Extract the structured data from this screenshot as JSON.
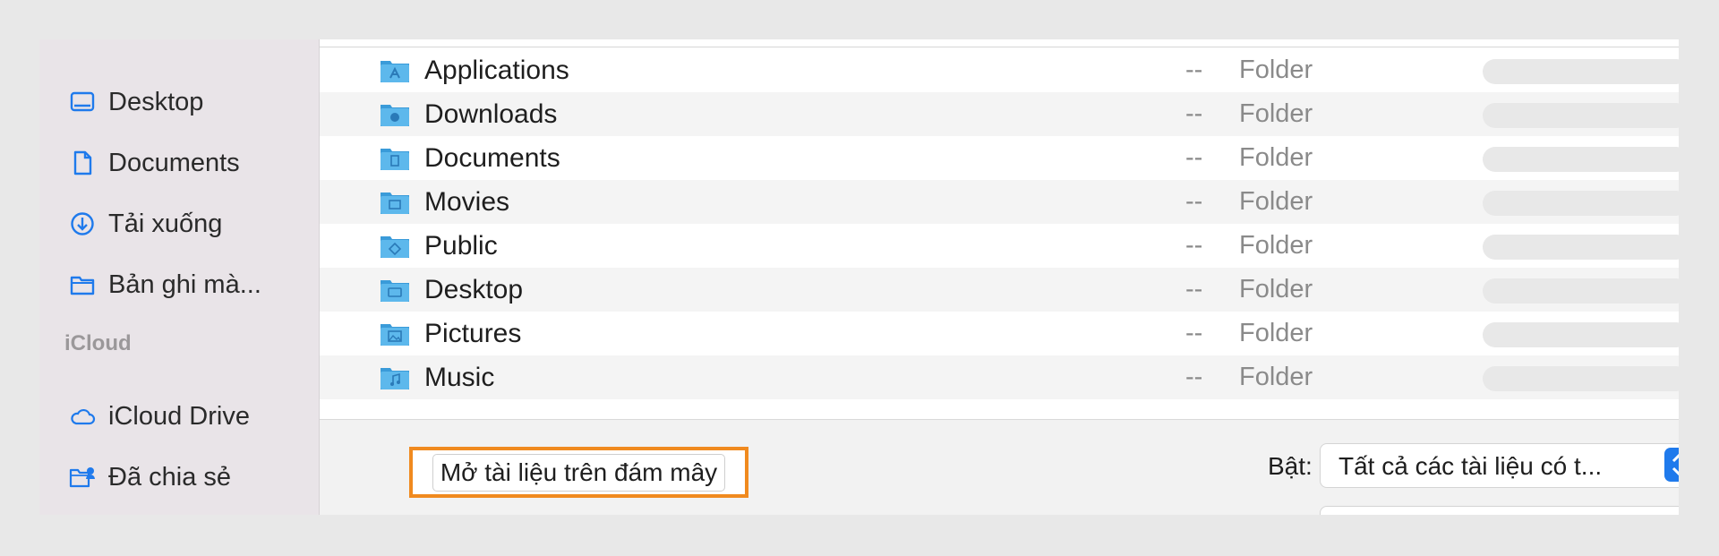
{
  "sidebar": {
    "items": [
      {
        "label": "Desktop",
        "icon": "desktop-icon"
      },
      {
        "label": "Documents",
        "icon": "document-icon"
      },
      {
        "label": "Tải xuống",
        "icon": "download-icon"
      },
      {
        "label": "Bản ghi mà...",
        "icon": "folder-icon"
      }
    ],
    "icloud_header": "iCloud",
    "icloud_items": [
      {
        "label": "iCloud Drive",
        "icon": "cloud-icon"
      },
      {
        "label": "Đã chia sẻ",
        "icon": "shared-folder-icon"
      }
    ]
  },
  "files": [
    {
      "name": "Applications",
      "size": "--",
      "kind": "Folder",
      "icon": "applications-folder-icon"
    },
    {
      "name": "Downloads",
      "size": "--",
      "kind": "Folder",
      "icon": "downloads-folder-icon"
    },
    {
      "name": "Documents",
      "size": "--",
      "kind": "Folder",
      "icon": "documents-folder-icon"
    },
    {
      "name": "Movies",
      "size": "--",
      "kind": "Folder",
      "icon": "movies-folder-icon"
    },
    {
      "name": "Public",
      "size": "--",
      "kind": "Folder",
      "icon": "public-folder-icon"
    },
    {
      "name": "Desktop",
      "size": "--",
      "kind": "Folder",
      "icon": "desktop-folder-icon"
    },
    {
      "name": "Pictures",
      "size": "--",
      "kind": "Folder",
      "icon": "pictures-folder-icon"
    },
    {
      "name": "Music",
      "size": "--",
      "kind": "Folder",
      "icon": "music-folder-icon"
    }
  ],
  "bottom": {
    "cloud_button": "Mở tài liệu trên đám mây",
    "enable_label": "Bật:",
    "filter_value": "Tất cả các tài liệu có t..."
  },
  "colors": {
    "accent": "#1f7aec",
    "highlight": "#f08a1f",
    "sidebar_bg": "#e9e4e8",
    "folder_blue": "#4aa8e0"
  }
}
